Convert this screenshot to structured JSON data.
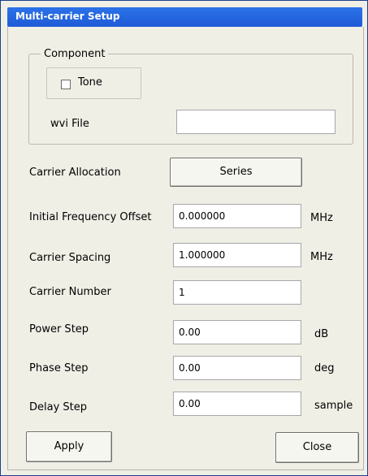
{
  "window": {
    "title": "Multi-carrier Setup"
  },
  "component": {
    "group_label": "Component",
    "tone_label": "Tone",
    "tone_checked": false,
    "wvi_file_label": "wvi File",
    "wvi_file_value": ""
  },
  "carrier_allocation": {
    "label": "Carrier Allocation",
    "button_label": "Series"
  },
  "fields": {
    "initial_frequency_offset": {
      "label": "Initial Frequency Offset",
      "value": "0.000000",
      "unit": "MHz"
    },
    "carrier_spacing": {
      "label": "Carrier Spacing",
      "value": "1.000000",
      "unit": "MHz"
    },
    "carrier_number": {
      "label": "Carrier Number",
      "value": "1",
      "unit": ""
    },
    "power_step": {
      "label": "Power Step",
      "value": "0.00",
      "unit": "dB"
    },
    "phase_step": {
      "label": "Phase Step",
      "value": "0.00",
      "unit": "deg"
    },
    "delay_step": {
      "label": "Delay Step",
      "value": "0.00",
      "unit": "sample"
    }
  },
  "buttons": {
    "apply": "Apply",
    "close": "Close"
  },
  "colors": {
    "titlebar": "#1e5bd6",
    "dialog_bg": "#f0efe6"
  }
}
